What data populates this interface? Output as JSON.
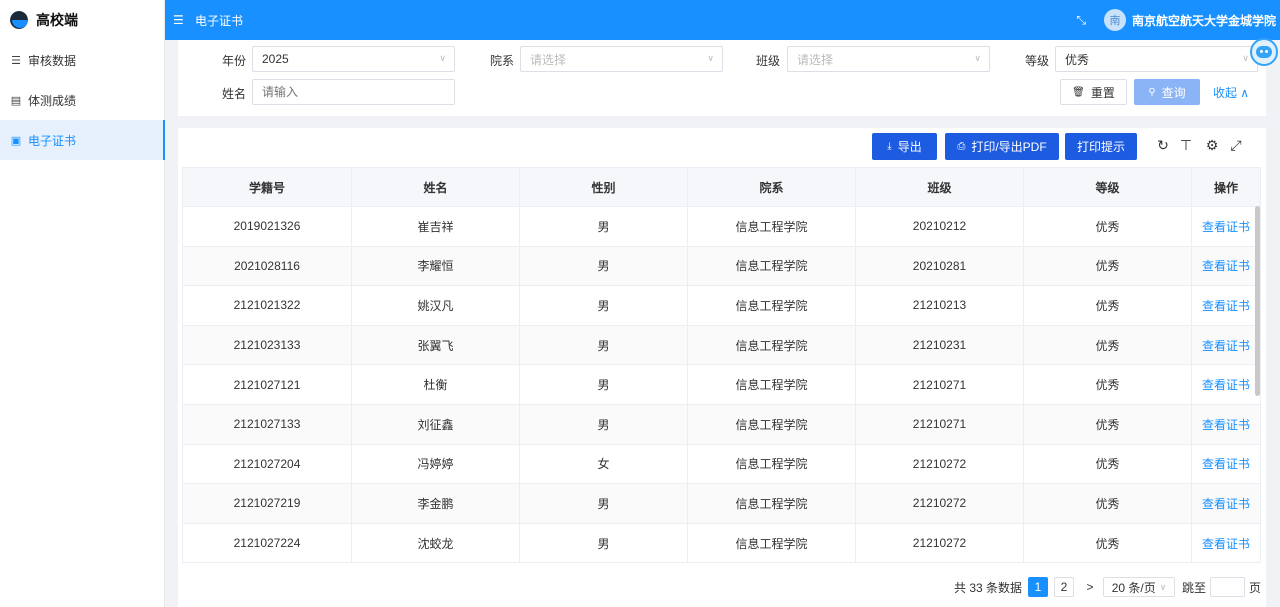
{
  "sidebar": {
    "brand": "高校端",
    "items": [
      {
        "label": "审核数据",
        "icon": "list-icon"
      },
      {
        "label": "体测成绩",
        "icon": "book-icon"
      },
      {
        "label": "电子证书",
        "icon": "document-icon",
        "active": true
      }
    ]
  },
  "header": {
    "title": "电子证书",
    "avatar": "南",
    "user": "南京航空航天大学金城学院"
  },
  "filter": {
    "year_label": "年份",
    "year_value": "2025",
    "dept_label": "院系",
    "dept_placeholder": "请选择",
    "class_label": "班级",
    "class_placeholder": "请选择",
    "grade_label": "等级",
    "grade_value": "优秀",
    "name_label": "姓名",
    "name_placeholder": "请输入",
    "reset_label": "重置",
    "query_label": "查询",
    "collapse_label": "收起 ∧"
  },
  "toolbar": {
    "export_label": "导出",
    "print_label": "打印/导出PDF",
    "hint_label": "打印提示"
  },
  "table": {
    "columns": [
      "学籍号",
      "姓名",
      "性别",
      "院系",
      "班级",
      "等级",
      "操作"
    ],
    "rows": [
      {
        "id": "2019021326",
        "name": "崔吉祥",
        "gender": "男",
        "dept": "信息工程学院",
        "cls": "20210212",
        "grade": "优秀",
        "op": "查看证书"
      },
      {
        "id": "2021028116",
        "name": "李耀恒",
        "gender": "男",
        "dept": "信息工程学院",
        "cls": "20210281",
        "grade": "优秀",
        "op": "查看证书"
      },
      {
        "id": "2121021322",
        "name": "姚汉凡",
        "gender": "男",
        "dept": "信息工程学院",
        "cls": "21210213",
        "grade": "优秀",
        "op": "查看证书"
      },
      {
        "id": "2121023133",
        "name": "张翼飞",
        "gender": "男",
        "dept": "信息工程学院",
        "cls": "21210231",
        "grade": "优秀",
        "op": "查看证书"
      },
      {
        "id": "2121027121",
        "name": "杜衡",
        "gender": "男",
        "dept": "信息工程学院",
        "cls": "21210271",
        "grade": "优秀",
        "op": "查看证书"
      },
      {
        "id": "2121027133",
        "name": "刘征鑫",
        "gender": "男",
        "dept": "信息工程学院",
        "cls": "21210271",
        "grade": "优秀",
        "op": "查看证书"
      },
      {
        "id": "2121027204",
        "name": "冯婷婷",
        "gender": "女",
        "dept": "信息工程学院",
        "cls": "21210272",
        "grade": "优秀",
        "op": "查看证书"
      },
      {
        "id": "2121027219",
        "name": "李金鹏",
        "gender": "男",
        "dept": "信息工程学院",
        "cls": "21210272",
        "grade": "优秀",
        "op": "查看证书"
      },
      {
        "id": "2121027224",
        "name": "沈蛟龙",
        "gender": "男",
        "dept": "信息工程学院",
        "cls": "21210272",
        "grade": "优秀",
        "op": "查看证书"
      }
    ]
  },
  "pagination": {
    "total_text": "共 33 条数据",
    "pages": [
      "1",
      "2"
    ],
    "current": "1",
    "next": ">",
    "page_size": "20 条/页",
    "jump_label": "跳至",
    "page_unit": "页"
  }
}
